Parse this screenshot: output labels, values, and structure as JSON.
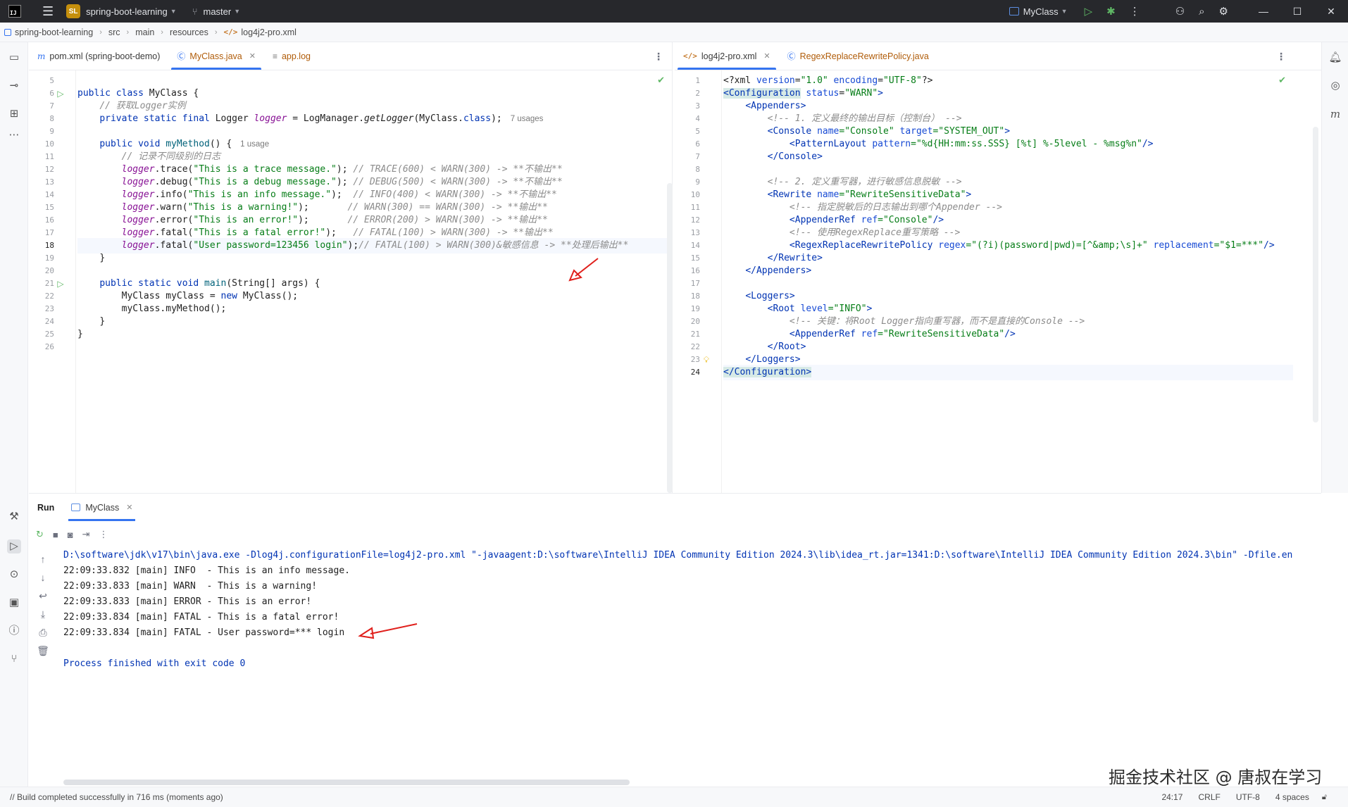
{
  "titlebar": {
    "project_badge": "SL",
    "project_name": "spring-boot-learning",
    "branch": "master",
    "run_config": "MyClass"
  },
  "breadcrumb": [
    "spring-boot-learning",
    "src",
    "main",
    "resources",
    "log4j2-pro.xml"
  ],
  "left_editor": {
    "tabs": [
      {
        "label": "pom.xml (spring-boot-demo)",
        "icon": "maven-icon"
      },
      {
        "label": "MyClass.java",
        "icon": "java-class-icon",
        "active": true,
        "closable": true
      },
      {
        "label": "app.log",
        "icon": "log-file-icon"
      }
    ],
    "line_numbers": [
      "5",
      "6",
      "7",
      "8",
      "9",
      "10",
      "11",
      "12",
      "13",
      "14",
      "15",
      "16",
      "17",
      "18",
      "19",
      "20",
      "21",
      "22",
      "23",
      "24",
      "25",
      "26"
    ],
    "current_line": "18",
    "hints": {
      "usages_7": "7 usages",
      "usages_1": "1 usage"
    },
    "code": {
      "l6": {
        "kw": "public class ",
        "name": "MyClass {"
      },
      "l7": "// 获取Logger实例",
      "l8": {
        "kw": "private static final ",
        "type": "Logger ",
        "field": "logger",
        "rest1": " = LogManager.",
        "call": "getLogger",
        "rest2": "(MyClass.",
        "cls": "class",
        "rest3": ");"
      },
      "l10": {
        "kw": "public void ",
        "name": "myMethod",
        "rest": "() {"
      },
      "l11": "// 记录不同级别的日志",
      "l12": {
        "field": "logger",
        "call": ".trace(",
        "str": "\"This is a trace message.\"",
        "end": ");",
        "comment": " // TRACE(600) < WARN(300) -> **不输出**"
      },
      "l13": {
        "field": "logger",
        "call": ".debug(",
        "str": "\"This is a debug message.\"",
        "end": ");",
        "comment": " // DEBUG(500) < WARN(300) -> **不输出**"
      },
      "l14": {
        "field": "logger",
        "call": ".info(",
        "str": "\"This is an info message.\"",
        "end": ");",
        "comment": "  // INFO(400) < WARN(300) -> **不输出**"
      },
      "l15": {
        "field": "logger",
        "call": ".warn(",
        "str": "\"This is a warning!\"",
        "end": ");",
        "comment": "       // WARN(300) == WARN(300) -> **输出**"
      },
      "l16": {
        "field": "logger",
        "call": ".error(",
        "str": "\"This is an error!\"",
        "end": ");",
        "comment": "       // ERROR(200) > WARN(300) -> **输出**"
      },
      "l17": {
        "field": "logger",
        "call": ".fatal(",
        "str": "\"This is a fatal error!\"",
        "end": ");",
        "comment": "   // FATAL(100) > WARN(300) -> **输出**"
      },
      "l18": {
        "field": "logger",
        "call": ".fatal(",
        "str": "\"User password=123456 login\"",
        "end": ");",
        "comment": "// FATAL(100) > WARN(300)&敏感信息 -> **处理后输出**"
      },
      "l19": "}",
      "l21": {
        "kw": "public static void ",
        "name": "main",
        "rest": "(String[] args) {"
      },
      "l22": {
        "pre": "MyClass myClass = ",
        "kw": "new ",
        "rest": "MyClass();"
      },
      "l23": {
        "pre": "myClass.",
        "call": "myMethod",
        "rest": "();"
      },
      "l24": "}",
      "l25": "}"
    }
  },
  "right_editor": {
    "tabs": [
      {
        "label": "log4j2-pro.xml",
        "icon": "xml-file-icon",
        "active": true,
        "closable": true
      },
      {
        "label": "RegexReplaceRewritePolicy.java",
        "icon": "java-class-icon"
      }
    ],
    "line_numbers": [
      "1",
      "2",
      "3",
      "4",
      "5",
      "6",
      "7",
      "8",
      "9",
      "10",
      "11",
      "12",
      "13",
      "14",
      "15",
      "16",
      "17",
      "18",
      "19",
      "20",
      "21",
      "22",
      "23",
      "24"
    ],
    "current_line": "24",
    "code": {
      "l1": {
        "a": "<?xml ",
        "b": "version",
        "c": "=",
        "d": "\"1.0\"",
        "e": " encoding",
        "f": "=",
        "g": "\"UTF-8\"",
        "h": "?>"
      },
      "l2": {
        "open": "<Configuration",
        "attr": " status",
        "eq": "=",
        "val": "\"WARN\"",
        "close": ">"
      },
      "l3": "<Appenders>",
      "l4": "<!-- 1. 定义最终的输出目标（控制台） -->",
      "l5": {
        "open": "<Console",
        "a1": " name",
        "v1": "=\"Console\"",
        "a2": " target",
        "v2": "=\"SYSTEM_OUT\"",
        "close": ">"
      },
      "l6": {
        "open": "<PatternLayout",
        "a1": " pattern",
        "v1": "=\"%d{HH:mm:ss.SSS} [%t] %-5level - %msg%n\"",
        "close": "/>"
      },
      "l7": "</Console>",
      "l9": "<!-- 2. 定义重写器，进行敏感信息脱敏 -->",
      "l10": {
        "open": "<Rewrite",
        "a1": " name",
        "v1": "=\"RewriteSensitiveData\"",
        "close": ">"
      },
      "l11": "<!-- 指定脱敏后的日志输出到哪个Appender -->",
      "l12": {
        "open": "<AppenderRef",
        "a1": " ref",
        "v1": "=\"Console\"",
        "close": "/>"
      },
      "l13": "<!-- 使用RegexReplace重写策略 -->",
      "l14": {
        "open": "<RegexReplaceRewritePolicy",
        "a1": " regex",
        "v1": "=\"(?i)(password|pwd)=[^&amp;\\s]+\"",
        "a2": " replacement",
        "v2": "=\"$1=***\"",
        "close": "/>"
      },
      "l15": "</Rewrite>",
      "l16": "</Appenders>",
      "l18": "<Loggers>",
      "l19": {
        "open": "<Root",
        "a1": " level",
        "v1": "=\"INFO\"",
        "close": ">"
      },
      "l20": "<!-- 关键：将Root Logger指向重写器，而不是直接的Console -->",
      "l21": {
        "open": "<AppenderRef",
        "a1": " ref",
        "v1": "=\"RewriteSensitiveData\"",
        "close": "/>"
      },
      "l22": "</Root>",
      "l23": "</Loggers>",
      "l24": "</Configuration>"
    }
  },
  "run_panel": {
    "title": "Run",
    "tab": "MyClass",
    "console": [
      "D:\\software\\jdk\\v17\\bin\\java.exe -Dlog4j.configurationFile=log4j2-pro.xml \"-javaagent:D:\\software\\IntelliJ IDEA Community Edition 2024.3\\lib\\idea_rt.jar=1341:D:\\software\\IntelliJ IDEA Community Edition 2024.3\\bin\" -Dfile.en",
      "22:09:33.832 [main] INFO  - This is an info message.",
      "22:09:33.833 [main] WARN  - This is a warning!",
      "22:09:33.833 [main] ERROR - This is an error!",
      "22:09:33.834 [main] FATAL - This is a fatal error!",
      "22:09:33.834 [main] FATAL - User password=*** login",
      "",
      "Process finished with exit code 0"
    ]
  },
  "statusbar": {
    "message": "// Build completed successfully in 716 ms (moments ago)",
    "position": "24:17",
    "line_ending": "CRLF",
    "encoding": "UTF-8",
    "indent": "4 spaces"
  },
  "watermark": "掘金技术社区 @ 唐叔在学习",
  "colors": {
    "accent": "#3574f0",
    "keyword": "#0033b3",
    "string": "#067d17",
    "comment": "#8c8c8c",
    "field": "#871094",
    "annotation_arrow": "#e0201c"
  }
}
